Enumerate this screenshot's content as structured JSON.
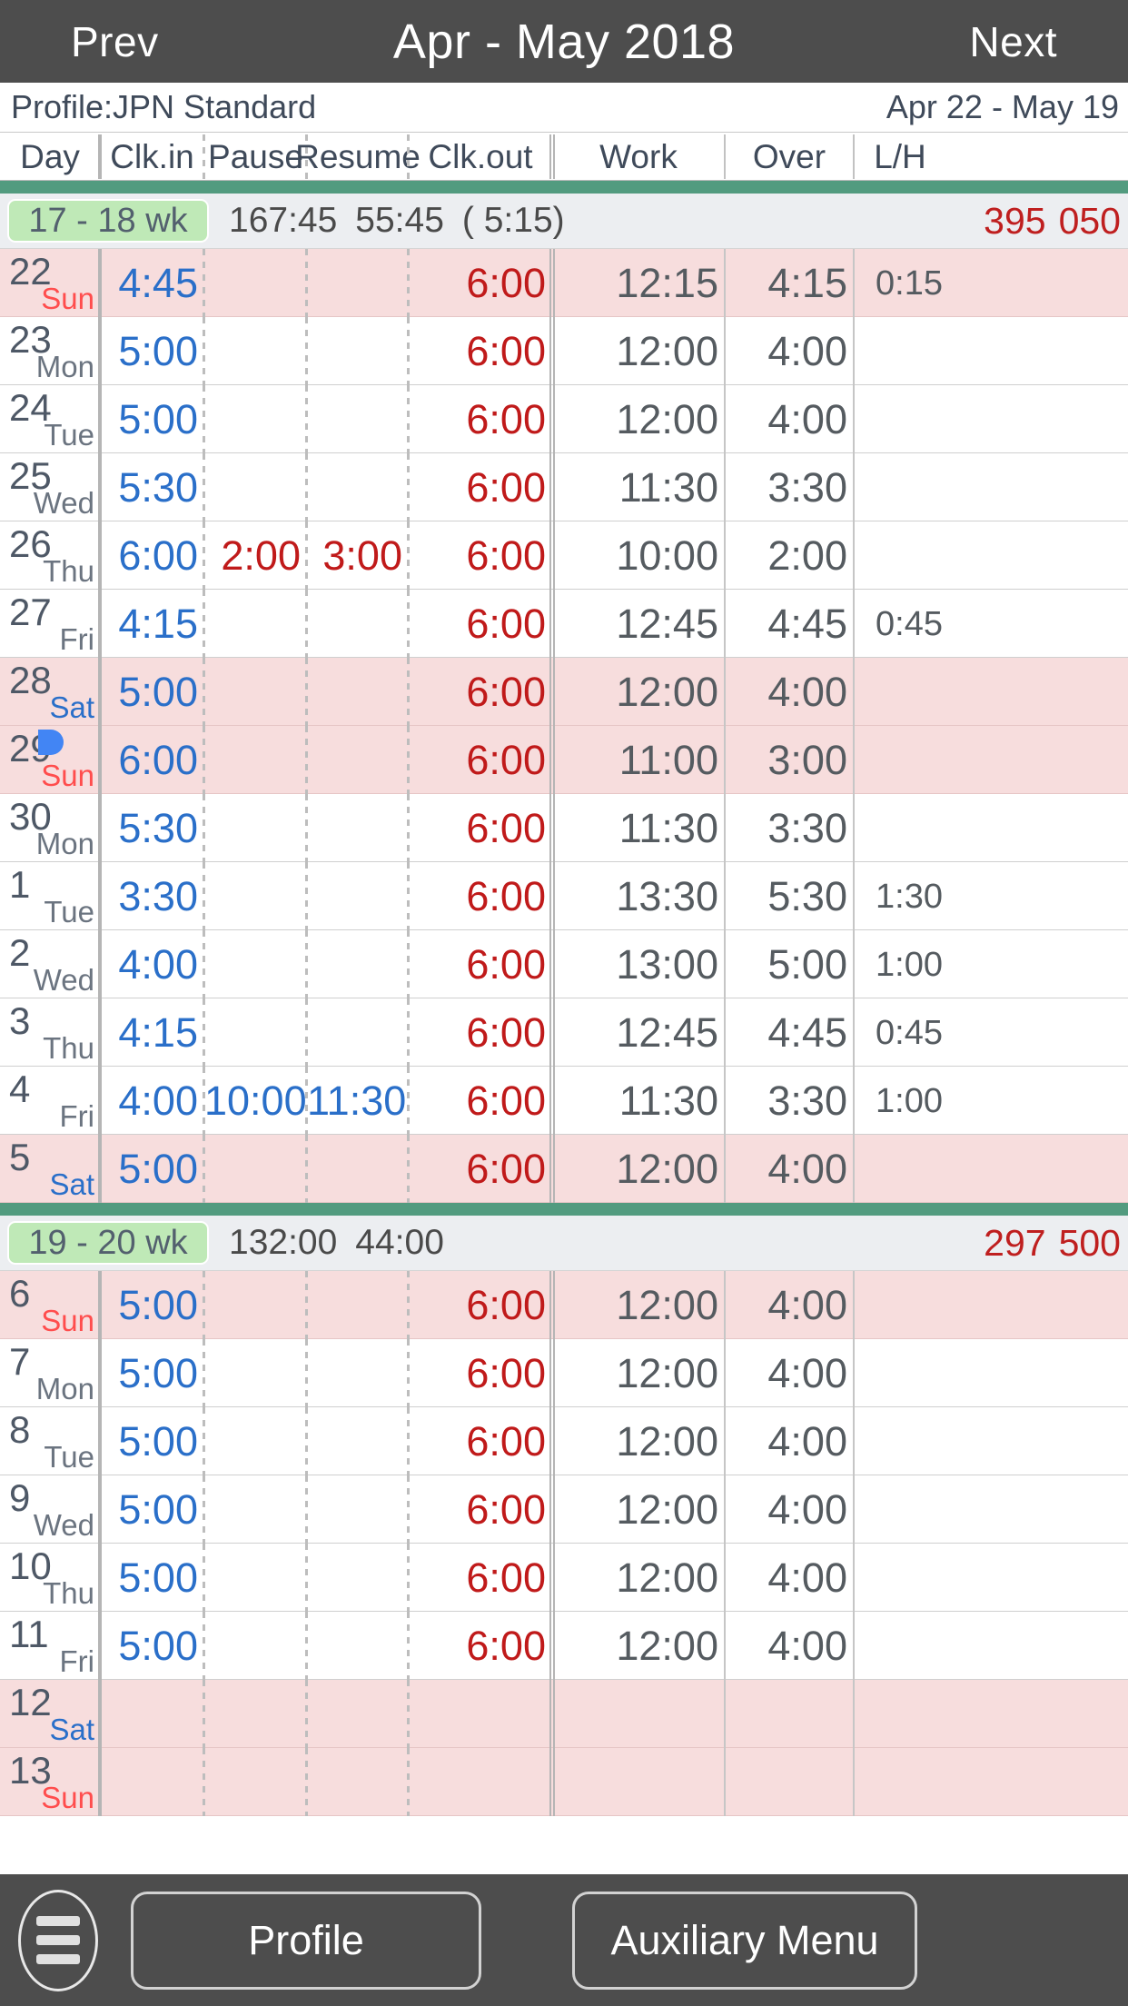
{
  "topbar": {
    "prev_label": "Prev",
    "title": "Apr - May 2018",
    "next_label": "Next"
  },
  "profilebar": {
    "profile_label": "Profile:JPN Standard",
    "date_range": "Apr 22 - May 19"
  },
  "columns": [
    {
      "key": "day",
      "label": "Day"
    },
    {
      "key": "clkin",
      "label": "Clk.in"
    },
    {
      "key": "pause",
      "label": "Pause"
    },
    {
      "key": "resume",
      "label": "Resume"
    },
    {
      "key": "clkout",
      "label": "Clk.out"
    },
    {
      "key": "work",
      "label": "Work"
    },
    {
      "key": "over",
      "label": "Over"
    },
    {
      "key": "lh",
      "label": "L/H"
    }
  ],
  "colors": {
    "topbar_bg": "#4d4d4d",
    "green_band": "#529b7f",
    "week_pill": "#bfe9b7",
    "week_row_bg": "#eceef1",
    "weekend_tint": "#f7dddd",
    "clock_in": "#2a6fc9",
    "clock_out": "#c01a1a",
    "money": "#bf1f1f",
    "sunday": "#ff4d4d",
    "saturday": "#2a6fc9"
  },
  "weeks": [
    {
      "pill": "17 - 18 wk",
      "total_work": "167:45",
      "total_over": "55:45",
      "paren": "( 5:15)",
      "money_a": "395",
      "money_b": "050",
      "rows": [
        {
          "day": "22",
          "dow": "Sun",
          "dow_type": "sun",
          "tint": true,
          "mark": false,
          "clkin": "4:45",
          "pause": "",
          "resume": "",
          "pz_color": "",
          "clkout": "6:00",
          "work": "12:15",
          "over": "4:15",
          "lh": "0:15"
        },
        {
          "day": "23",
          "dow": "Mon",
          "dow_type": "wd",
          "tint": false,
          "mark": false,
          "clkin": "5:00",
          "pause": "",
          "resume": "",
          "pz_color": "",
          "clkout": "6:00",
          "work": "12:00",
          "over": "4:00",
          "lh": ""
        },
        {
          "day": "24",
          "dow": "Tue",
          "dow_type": "wd",
          "tint": false,
          "mark": false,
          "clkin": "5:00",
          "pause": "",
          "resume": "",
          "pz_color": "",
          "clkout": "6:00",
          "work": "12:00",
          "over": "4:00",
          "lh": ""
        },
        {
          "day": "25",
          "dow": "Wed",
          "dow_type": "wd",
          "tint": false,
          "mark": false,
          "clkin": "5:30",
          "pause": "",
          "resume": "",
          "pz_color": "",
          "clkout": "6:00",
          "work": "11:30",
          "over": "3:30",
          "lh": ""
        },
        {
          "day": "26",
          "dow": "Thu",
          "dow_type": "wd",
          "tint": false,
          "mark": false,
          "clkin": "6:00",
          "pause": "2:00",
          "resume": "3:00",
          "pz_color": "red",
          "clkout": "6:00",
          "work": "10:00",
          "over": "2:00",
          "lh": ""
        },
        {
          "day": "27",
          "dow": "Fri",
          "dow_type": "wd",
          "tint": false,
          "mark": false,
          "clkin": "4:15",
          "pause": "",
          "resume": "",
          "pz_color": "",
          "clkout": "6:00",
          "work": "12:45",
          "over": "4:45",
          "lh": "0:45"
        },
        {
          "day": "28",
          "dow": "Sat",
          "dow_type": "sat",
          "tint": true,
          "mark": false,
          "clkin": "5:00",
          "pause": "",
          "resume": "",
          "pz_color": "",
          "clkout": "6:00",
          "work": "12:00",
          "over": "4:00",
          "lh": ""
        },
        {
          "day": "29",
          "dow": "Sun",
          "dow_type": "sun",
          "tint": true,
          "mark": true,
          "clkin": "6:00",
          "pause": "",
          "resume": "",
          "pz_color": "",
          "clkout": "6:00",
          "work": "11:00",
          "over": "3:00",
          "lh": ""
        },
        {
          "day": "30",
          "dow": "Mon",
          "dow_type": "wd",
          "tint": false,
          "mark": false,
          "clkin": "5:30",
          "pause": "",
          "resume": "",
          "pz_color": "",
          "clkout": "6:00",
          "work": "11:30",
          "over": "3:30",
          "lh": ""
        },
        {
          "day": "1",
          "dow": "Tue",
          "dow_type": "wd",
          "tint": false,
          "mark": false,
          "clkin": "3:30",
          "pause": "",
          "resume": "",
          "pz_color": "",
          "clkout": "6:00",
          "work": "13:30",
          "over": "5:30",
          "lh": "1:30"
        },
        {
          "day": "2",
          "dow": "Wed",
          "dow_type": "wd",
          "tint": false,
          "mark": false,
          "clkin": "4:00",
          "pause": "",
          "resume": "",
          "pz_color": "",
          "clkout": "6:00",
          "work": "13:00",
          "over": "5:00",
          "lh": "1:00"
        },
        {
          "day": "3",
          "dow": "Thu",
          "dow_type": "wd",
          "tint": false,
          "mark": false,
          "clkin": "4:15",
          "pause": "",
          "resume": "",
          "pz_color": "",
          "clkout": "6:00",
          "work": "12:45",
          "over": "4:45",
          "lh": "0:45"
        },
        {
          "day": "4",
          "dow": "Fri",
          "dow_type": "wd",
          "tint": false,
          "mark": false,
          "clkin": "4:00",
          "pause": "10:00",
          "resume": "11:30",
          "pz_color": "blue",
          "clkout": "6:00",
          "work": "11:30",
          "over": "3:30",
          "lh": "1:00"
        },
        {
          "day": "5",
          "dow": "Sat",
          "dow_type": "sat",
          "tint": true,
          "mark": false,
          "clkin": "5:00",
          "pause": "",
          "resume": "",
          "pz_color": "",
          "clkout": "6:00",
          "work": "12:00",
          "over": "4:00",
          "lh": ""
        }
      ]
    },
    {
      "pill": "19 - 20 wk",
      "total_work": "132:00",
      "total_over": "44:00",
      "paren": "",
      "money_a": "297",
      "money_b": "500",
      "rows": [
        {
          "day": "6",
          "dow": "Sun",
          "dow_type": "sun",
          "tint": true,
          "mark": false,
          "clkin": "5:00",
          "pause": "",
          "resume": "",
          "pz_color": "",
          "clkout": "6:00",
          "work": "12:00",
          "over": "4:00",
          "lh": ""
        },
        {
          "day": "7",
          "dow": "Mon",
          "dow_type": "wd",
          "tint": false,
          "mark": false,
          "clkin": "5:00",
          "pause": "",
          "resume": "",
          "pz_color": "",
          "clkout": "6:00",
          "work": "12:00",
          "over": "4:00",
          "lh": ""
        },
        {
          "day": "8",
          "dow": "Tue",
          "dow_type": "wd",
          "tint": false,
          "mark": false,
          "clkin": "5:00",
          "pause": "",
          "resume": "",
          "pz_color": "",
          "clkout": "6:00",
          "work": "12:00",
          "over": "4:00",
          "lh": ""
        },
        {
          "day": "9",
          "dow": "Wed",
          "dow_type": "wd",
          "tint": false,
          "mark": false,
          "clkin": "5:00",
          "pause": "",
          "resume": "",
          "pz_color": "",
          "clkout": "6:00",
          "work": "12:00",
          "over": "4:00",
          "lh": ""
        },
        {
          "day": "10",
          "dow": "Thu",
          "dow_type": "wd",
          "tint": false,
          "mark": false,
          "clkin": "5:00",
          "pause": "",
          "resume": "",
          "pz_color": "",
          "clkout": "6:00",
          "work": "12:00",
          "over": "4:00",
          "lh": ""
        },
        {
          "day": "11",
          "dow": "Fri",
          "dow_type": "wd",
          "tint": false,
          "mark": false,
          "clkin": "5:00",
          "pause": "",
          "resume": "",
          "pz_color": "",
          "clkout": "6:00",
          "work": "12:00",
          "over": "4:00",
          "lh": ""
        },
        {
          "day": "12",
          "dow": "Sat",
          "dow_type": "sat",
          "tint": true,
          "mark": false,
          "clkin": "",
          "pause": "",
          "resume": "",
          "pz_color": "",
          "clkout": "",
          "work": "",
          "over": "",
          "lh": ""
        },
        {
          "day": "13",
          "dow": "Sun",
          "dow_type": "sun",
          "tint": true,
          "mark": false,
          "clkin": "",
          "pause": "",
          "resume": "",
          "pz_color": "",
          "clkout": "",
          "work": "",
          "over": "",
          "lh": ""
        }
      ]
    }
  ],
  "footer": {
    "menu_icon": "hamburger-icon",
    "profile_label": "Profile",
    "aux_label": "Auxiliary Menu"
  }
}
